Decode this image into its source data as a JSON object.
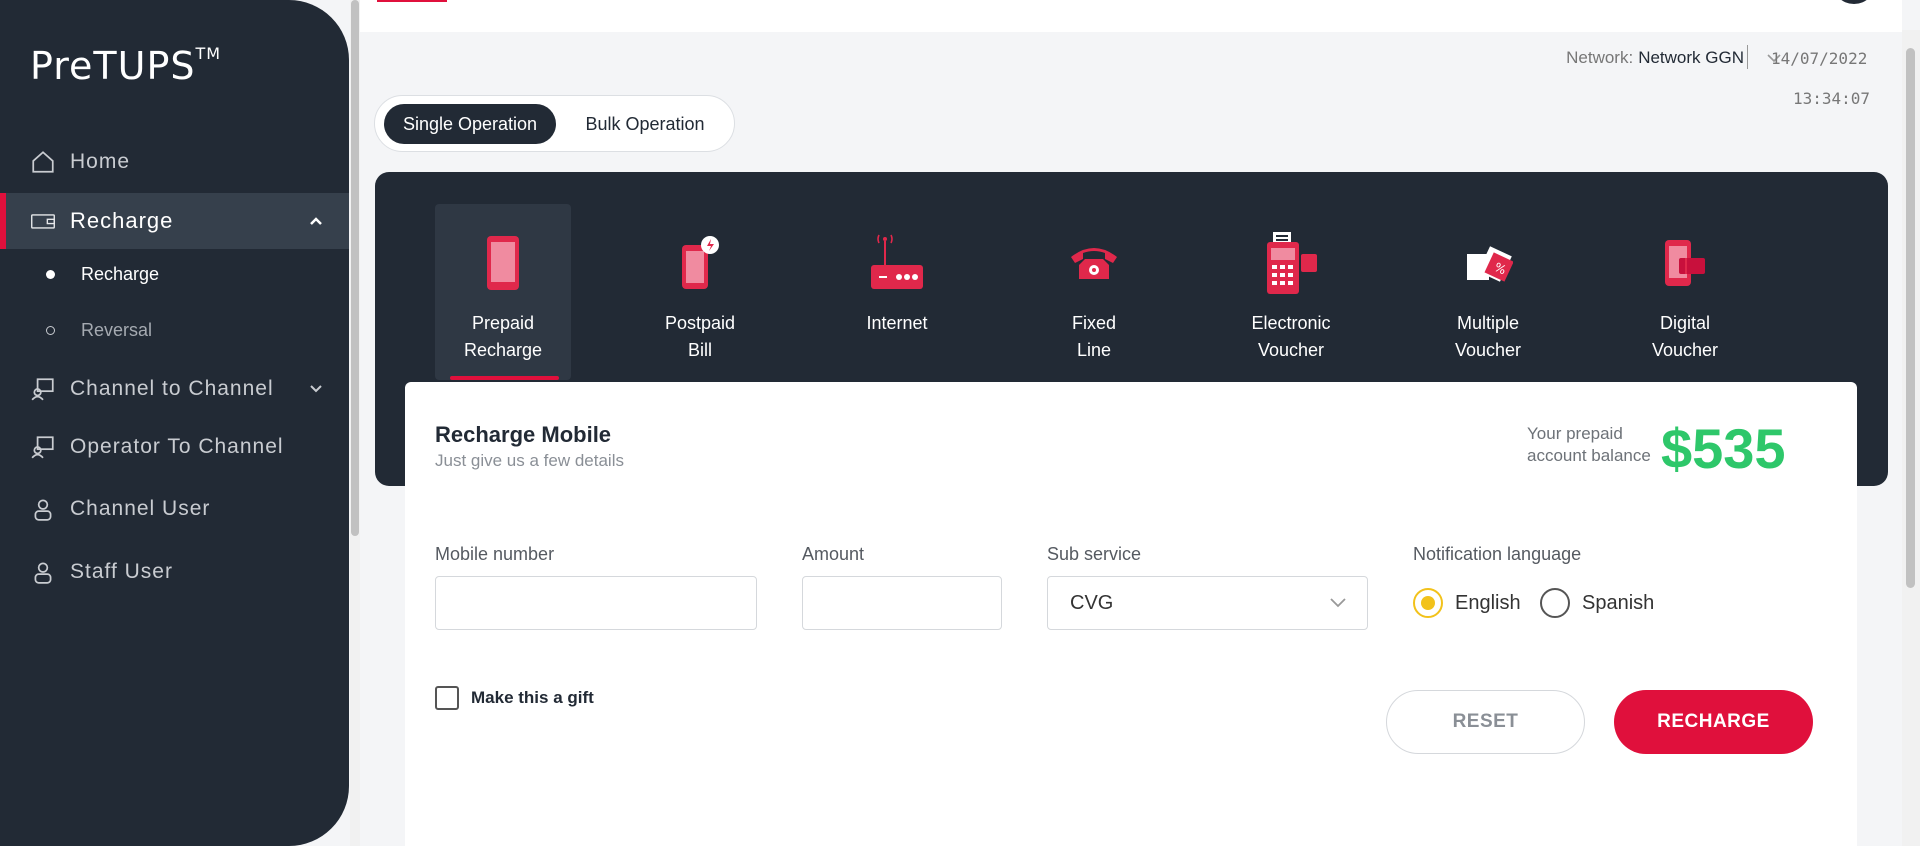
{
  "app": {
    "logo": "PreTUPS",
    "logo_mark": "TM"
  },
  "sidebar": {
    "items": [
      {
        "label": "Home",
        "icon": "home-icon"
      },
      {
        "label": "Recharge",
        "icon": "wallet-icon",
        "expanded": true
      },
      {
        "label": "Channel to Channel",
        "icon": "transfer-icon"
      },
      {
        "label": "Operator To Channel",
        "icon": "transfer-icon"
      },
      {
        "label": "Channel User",
        "icon": "user-icon"
      },
      {
        "label": "Staff User",
        "icon": "user-icon"
      }
    ],
    "sub_items": [
      {
        "label": "Recharge",
        "selected": true
      },
      {
        "label": "Reversal",
        "selected": false
      }
    ]
  },
  "header": {
    "network_label": "Network:",
    "network_value": "Network GGN",
    "date": "14/07/2022",
    "time": "13:34:07"
  },
  "operation_toggle": {
    "options": [
      "Single Operation",
      "Bulk Operation"
    ],
    "selected": "Single Operation"
  },
  "services": [
    {
      "line1": "Prepaid",
      "line2": "Recharge",
      "icon": "mobile-phone-icon",
      "active": true
    },
    {
      "line1": "Postpaid",
      "line2": "Bill",
      "icon": "mobile-bill-icon"
    },
    {
      "line1": "Internet",
      "line2": "",
      "icon": "router-icon"
    },
    {
      "line1": "Fixed",
      "line2": "Line",
      "icon": "telephone-icon"
    },
    {
      "line1": "Electronic",
      "line2": "Voucher",
      "icon": "pos-terminal-icon"
    },
    {
      "line1": "Multiple",
      "line2": "Voucher",
      "icon": "vouchers-icon"
    },
    {
      "line1": "Digital",
      "line2": "Voucher",
      "icon": "digital-voucher-icon"
    }
  ],
  "form": {
    "title": "Recharge Mobile",
    "subtitle": "Just give us a few details",
    "balance_label": "Your prepaid account balance",
    "balance_value": "$535",
    "mobile_label": "Mobile number",
    "mobile_value": "",
    "amount_label": "Amount",
    "amount_value": "",
    "sub_service_label": "Sub service",
    "sub_service_value": "CVG",
    "notification_label": "Notification language",
    "languages": [
      "English",
      "Spanish"
    ],
    "selected_language": "English",
    "gift_label": "Make this a gift",
    "reset_label": "RESET",
    "recharge_label": "RECHARGE"
  },
  "colors": {
    "sidebar_bg": "#222a35",
    "accent": "#e0103c",
    "balance": "#2ec76a",
    "radio": "#f2c21b"
  }
}
